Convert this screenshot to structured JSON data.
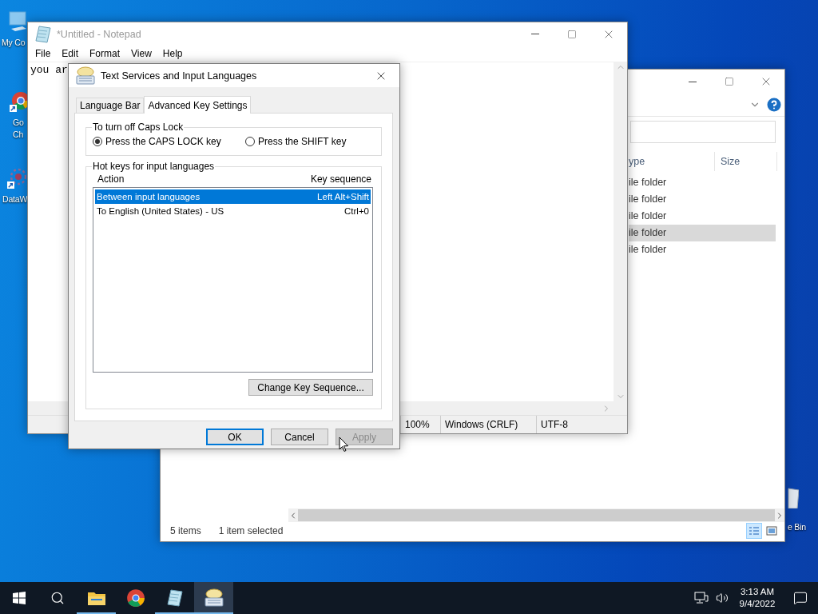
{
  "desktop": {
    "icons": [
      {
        "kind": "computer",
        "shortcut": false,
        "lines": [
          "My Co"
        ]
      },
      {
        "kind": "chrome",
        "shortcut": true,
        "lines": [
          "Go",
          "Ch"
        ]
      },
      {
        "kind": "app",
        "shortcut": true,
        "lines": [
          "DataW"
        ]
      },
      {
        "kind": "recycle",
        "shortcut": false,
        "lines": [
          "e Bin"
        ]
      }
    ]
  },
  "explorer": {
    "columns": [
      "ype",
      "Size"
    ],
    "rows": [
      {
        "type": "ile folder",
        "selected": false
      },
      {
        "type": "ile folder",
        "selected": false
      },
      {
        "type": "ile folder",
        "selected": false
      },
      {
        "type": "ile folder",
        "selected": true
      },
      {
        "type": "ile folder",
        "selected": false
      }
    ],
    "status": [
      "5 items",
      "1 item selected"
    ],
    "views": [
      {
        "kind": "details",
        "selected": true
      },
      {
        "kind": "tiles",
        "selected": false
      }
    ]
  },
  "notepad": {
    "title": "*Untitled - Notepad",
    "menu": [
      "File",
      "Edit",
      "Format",
      "View",
      "Help"
    ],
    "text": "you ar",
    "status": [
      "100%",
      "Windows (CRLF)",
      "UTF-8"
    ]
  },
  "dialog": {
    "title": "Text Services and Input Languages",
    "tabs": [
      {
        "label": "Language Bar",
        "selected": false
      },
      {
        "label": "Advanced Key Settings",
        "selected": true
      }
    ],
    "caps_lock": {
      "title": "To turn off Caps Lock",
      "options": [
        {
          "label": "Press the CAPS LOCK key",
          "selected": true
        },
        {
          "label": "Press the SHIFT key",
          "selected": false
        }
      ]
    },
    "hotkeys": {
      "title": "Hot keys for input languages",
      "columns": [
        "Action",
        "Key sequence"
      ],
      "rows": [
        {
          "action": "Between input languages",
          "sequence": "Left Alt+Shift",
          "selected": true
        },
        {
          "action": "To English (United States) - US",
          "sequence": "Ctrl+0",
          "selected": false
        }
      ],
      "button": "Change Key Sequence..."
    },
    "buttons": [
      {
        "label": "OK",
        "default": true,
        "disabled": false
      },
      {
        "label": "Cancel",
        "default": false,
        "disabled": false
      },
      {
        "label": "Apply",
        "default": false,
        "disabled": true
      }
    ]
  },
  "taskbar": {
    "apps": [
      {
        "kind": "explorer",
        "running": true,
        "active": false
      },
      {
        "kind": "chrome",
        "running": false,
        "active": false
      },
      {
        "kind": "notepad",
        "running": true,
        "active": false
      },
      {
        "kind": "keyboard",
        "running": true,
        "active": true
      }
    ],
    "time": "3:13 AM",
    "date": "9/4/2022"
  }
}
